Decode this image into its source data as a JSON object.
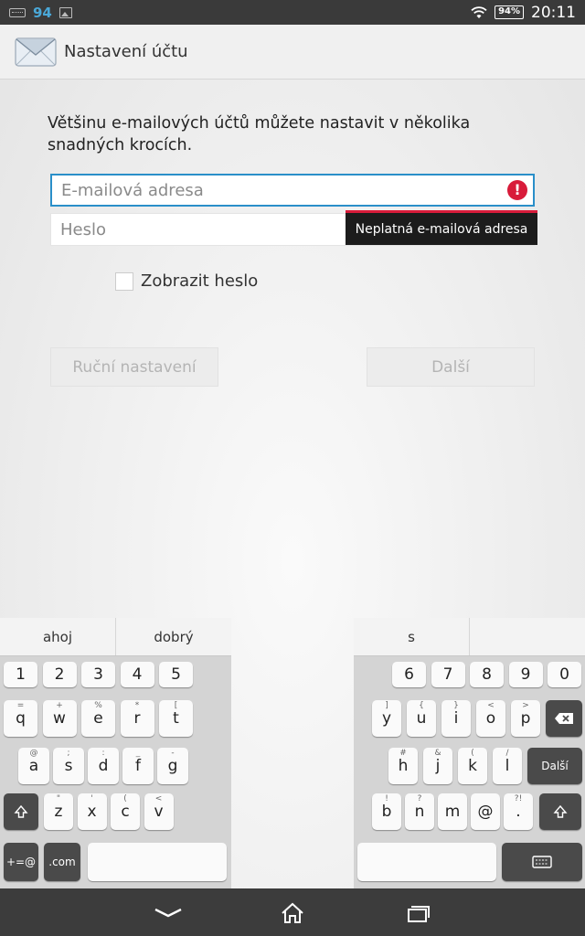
{
  "status_bar": {
    "notification_count": "94",
    "battery": "94%",
    "time": "20:11"
  },
  "action_bar": {
    "title": "Nastavení účtu",
    "icon": "envelope-icon"
  },
  "form": {
    "intro": "Většinu e-mailových účtů můžete nastavit v několika snadných krocích.",
    "email_placeholder": "E-mailová adresa",
    "password_placeholder": "Heslo",
    "error_tooltip": "Neplatná e-mailová adresa",
    "show_password_label": "Zobrazit heslo",
    "manual_setup_label": "Ruční nastavení",
    "next_label": "Další"
  },
  "keyboard": {
    "left_suggestions": [
      "ahoj",
      "dobrý"
    ],
    "right_suggestions": [
      "s",
      ""
    ],
    "left": {
      "row1": [
        {
          "k": "1"
        },
        {
          "k": "2"
        },
        {
          "k": "3"
        },
        {
          "k": "4"
        },
        {
          "k": "5"
        }
      ],
      "row2": [
        {
          "k": "q",
          "s": "="
        },
        {
          "k": "w",
          "s": "+"
        },
        {
          "k": "e",
          "s": "%"
        },
        {
          "k": "r",
          "s": "*"
        },
        {
          "k": "t",
          "s": "["
        }
      ],
      "row3": [
        {
          "k": "a",
          "s": "@"
        },
        {
          "k": "s",
          "s": ";"
        },
        {
          "k": "d",
          "s": ":"
        },
        {
          "k": "f",
          "s": "_"
        },
        {
          "k": "g",
          "s": "-"
        }
      ],
      "row4": [
        {
          "k": "z",
          "s": "\""
        },
        {
          "k": "x",
          "s": "'"
        },
        {
          "k": "c",
          "s": "("
        },
        {
          "k": "v",
          "s": "<"
        }
      ],
      "symbols": "+=@",
      "com": ".com"
    },
    "right": {
      "row1": [
        {
          "k": "6"
        },
        {
          "k": "7"
        },
        {
          "k": "8"
        },
        {
          "k": "9"
        },
        {
          "k": "0"
        }
      ],
      "row2": [
        {
          "k": "y",
          "s": "]"
        },
        {
          "k": "u",
          "s": "{"
        },
        {
          "k": "i",
          "s": "}"
        },
        {
          "k": "o",
          "s": "<"
        },
        {
          "k": "p",
          "s": ">"
        }
      ],
      "row3": [
        {
          "k": "h",
          "s": "#"
        },
        {
          "k": "j",
          "s": "&"
        },
        {
          "k": "k",
          "s": "("
        },
        {
          "k": "l",
          "s": "/"
        }
      ],
      "row4": [
        {
          "k": "b",
          "s": "!"
        },
        {
          "k": "n",
          "s": "?"
        },
        {
          "k": "m",
          "s": ""
        },
        {
          "k": "@",
          "s": ""
        },
        {
          "k": ".",
          "s": "?!"
        }
      ],
      "enter": "Další"
    }
  },
  "nav_bar": {
    "back": "back-chevron-icon",
    "home": "home-icon",
    "recents": "recents-icon"
  }
}
